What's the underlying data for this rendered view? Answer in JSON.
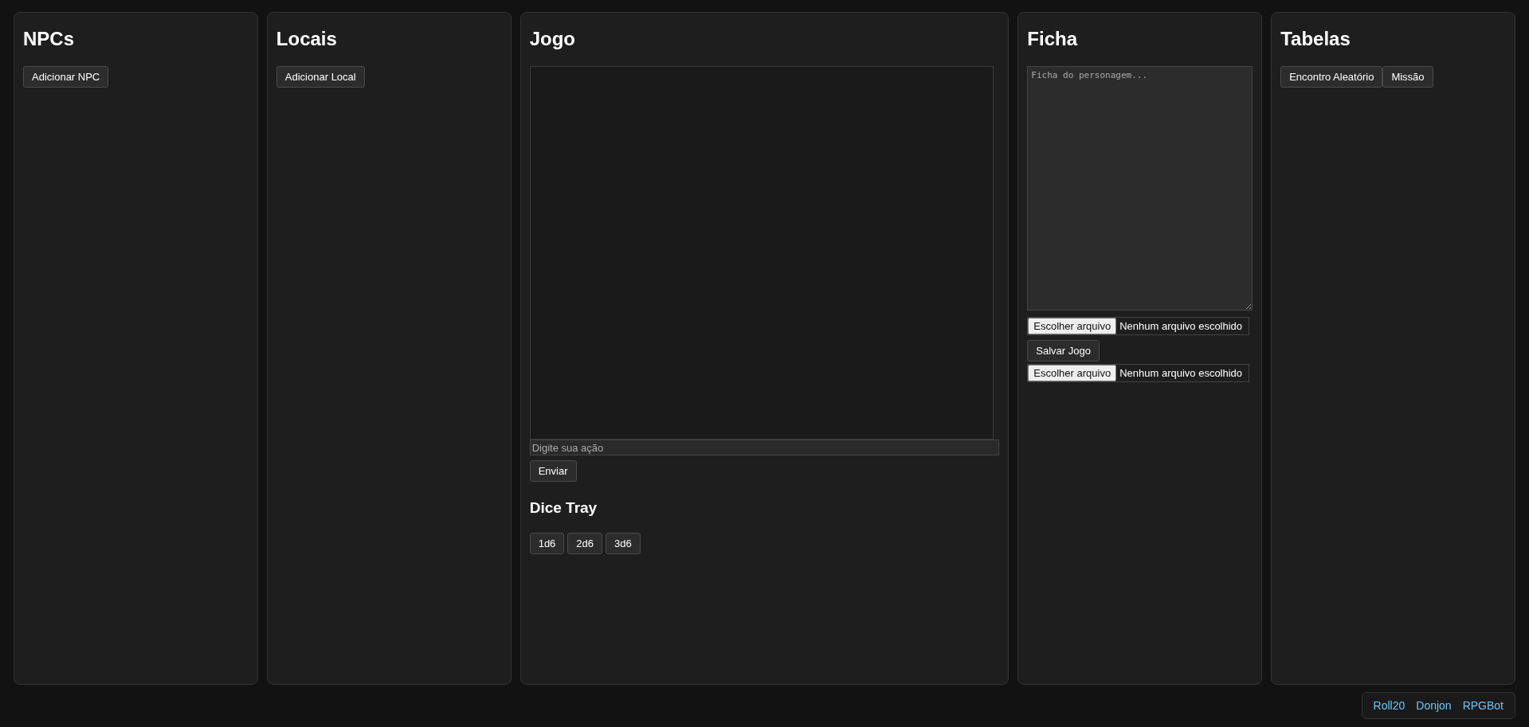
{
  "panels": [
    {
      "kind": "list",
      "title": "NPCs",
      "buttons": [
        "Adicionar NPC"
      ]
    },
    {
      "kind": "list",
      "title": "Locais",
      "buttons": [
        "Adicionar Local"
      ]
    },
    {
      "kind": "game",
      "title": "Jogo",
      "input": {
        "placeholder": "Digite sua ação"
      },
      "send_button": "Enviar",
      "dice_title": "Dice Tray",
      "dice": [
        "1d6",
        "2d6",
        "3d6"
      ]
    },
    {
      "kind": "sheet",
      "title": "Ficha",
      "textarea": {
        "placeholder": "Ficha do personagem..."
      },
      "file_button": "Escolher arquivo",
      "file_status": "Nenhum arquivo escolhido",
      "save_button": "Salvar Jogo",
      "file_button_2": "Escolher arquivo",
      "file_status_2": "Nenhum arquivo escolhido"
    },
    {
      "kind": "list",
      "title": "Tabelas",
      "buttons": [
        "Encontro Aleatório",
        "Missão"
      ]
    }
  ],
  "footer_links": [
    "Roll20",
    "Donjon",
    "RPGBot"
  ]
}
